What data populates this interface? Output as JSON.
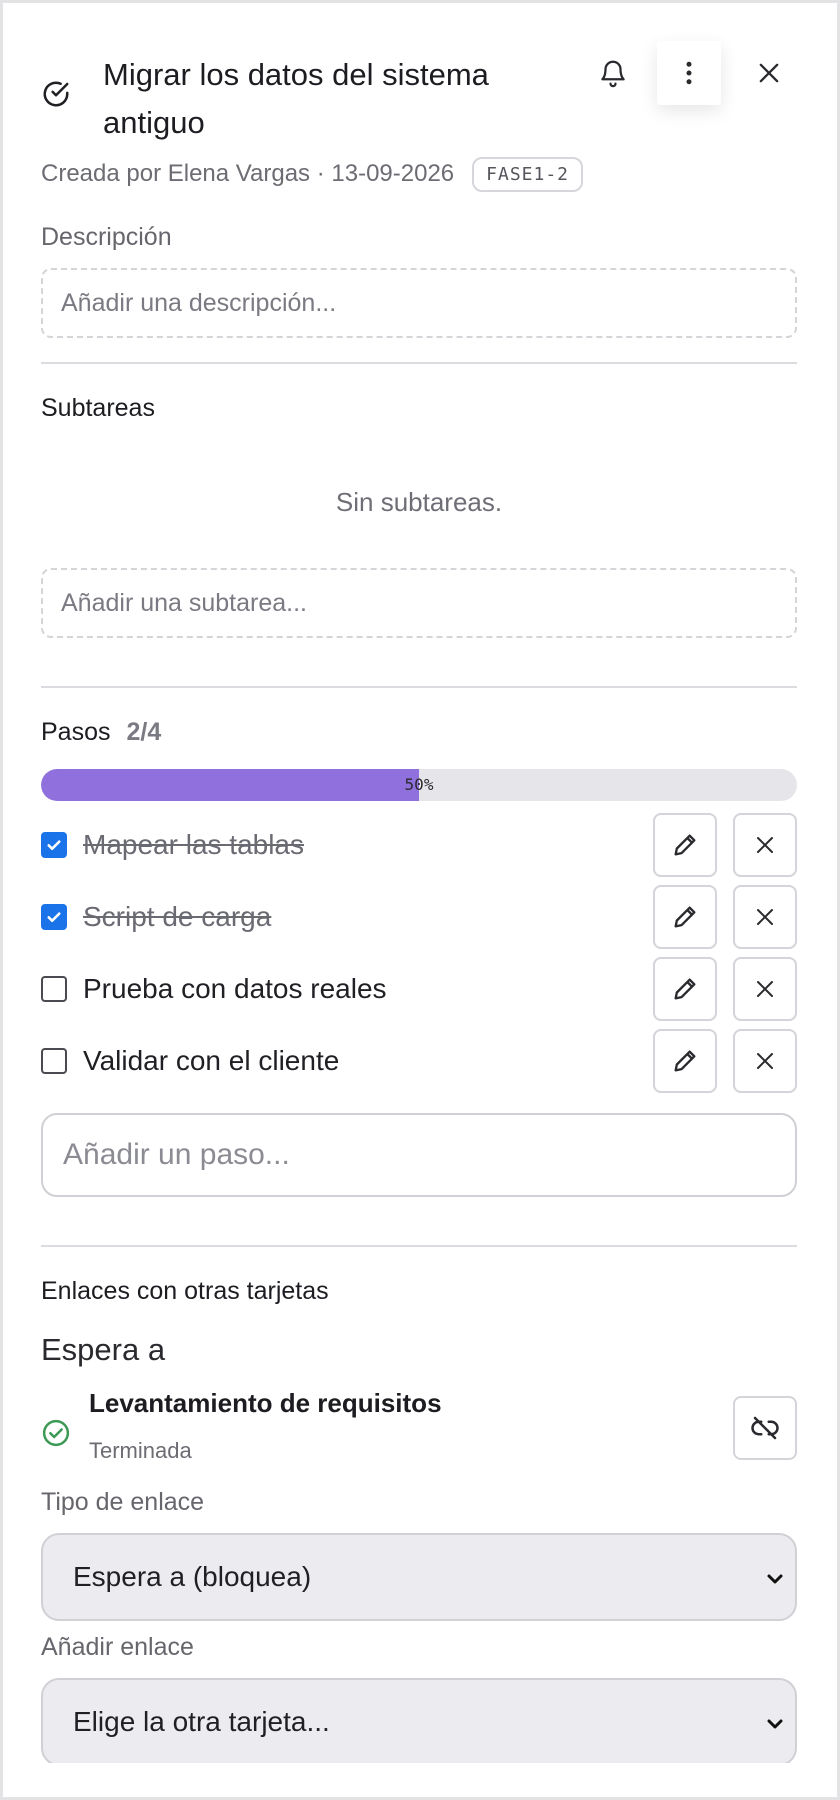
{
  "header": {
    "title": "Migrar los datos del sistema antiguo",
    "meta": "Creada por Elena Vargas · 13-09-2026",
    "code": "FASE1-2"
  },
  "description": {
    "label": "Descripción",
    "placeholder": "Añadir una descripción..."
  },
  "subtasks": {
    "title": "Subtareas",
    "empty": "Sin subtareas.",
    "placeholder": "Añadir una subtarea..."
  },
  "steps": {
    "title": "Pasos",
    "count": "2/4",
    "progress_percent": 50,
    "progress_label": "50%",
    "items": [
      {
        "label": "Mapear las tablas",
        "done": true
      },
      {
        "label": "Script de carga",
        "done": true
      },
      {
        "label": "Prueba con datos reales",
        "done": false
      },
      {
        "label": "Validar con el cliente",
        "done": false
      }
    ],
    "add_placeholder": "Añadir un paso..."
  },
  "links": {
    "title": "Enlaces con otras tarjetas",
    "group_title": "Espera a",
    "card_title": "Levantamiento de requisitos",
    "card_status": "Terminada",
    "type_label": "Tipo de enlace",
    "type_value": "Espera a (bloquea)",
    "add_label": "Añadir enlace",
    "add_value": "Elige la otra tarjeta..."
  },
  "colors": {
    "accent": "#9070dc",
    "checkbox": "#1a73e8",
    "success": "#3c9a55"
  },
  "icons": [
    "check-circle-icon",
    "bell-icon",
    "more-vertical-icon",
    "close-icon",
    "pencil-icon",
    "x-icon",
    "unlink-icon",
    "chevron-down-icon"
  ]
}
